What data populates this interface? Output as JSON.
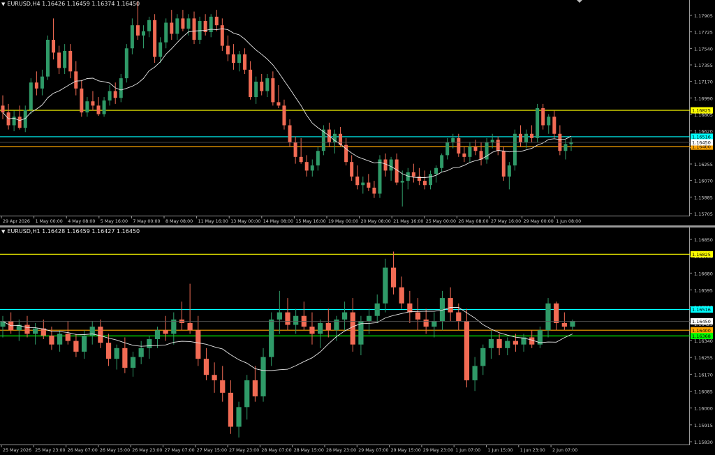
{
  "colors": {
    "bull": "#2f9a68",
    "bear": "#f26b54",
    "ma": "#e6e6e6",
    "axis_text": "#d0d0d0",
    "frame": "#9a9a9a",
    "background": "#000000",
    "price_label": "#ffffff"
  },
  "chart_data": [
    {
      "type": "candlestick",
      "header": "EURUSD,H4  1.16426 1.16459 1.16374 1.16450",
      "ylim": [
        1.1565,
        1.1805
      ],
      "y_ticks": [
        "1.17905",
        "1.17725",
        "1.17540",
        "1.17355",
        "1.17170",
        "1.16990",
        "1.16805",
        "1.16620",
        "1.16435",
        "1.16255",
        "1.16070",
        "1.15885",
        "1.15705"
      ],
      "x_ticks": [
        "29 Apr 2026",
        "1 May 00:00",
        "4 May 08:00",
        "5 May 16:00",
        "7 May 00:00",
        "8 May 08:00",
        "11 May 16:00",
        "13 May 00:00",
        "14 May 08:00",
        "15 May 16:00",
        "19 May 00:00",
        "20 May 08:00",
        "21 May 16:00",
        "25 May 00:00",
        "26 May 08:00",
        "27 May 16:00",
        "29 May 00:00",
        "1 Jun 08:00"
      ],
      "levels": [
        {
          "price": 1.16825,
          "label": "1.16825",
          "color": "#ffff00"
        },
        {
          "price": 1.16516,
          "label": "1.16516",
          "color": "#00ffff"
        },
        {
          "price": 1.164,
          "label": "1.16400",
          "color": "#ffa500"
        }
      ],
      "current_price": {
        "price": 1.1645,
        "label": "1.16450"
      },
      "ohlc": [
        [
          1.1688,
          1.17,
          1.1672,
          1.168
        ],
        [
          1.168,
          1.169,
          1.166,
          1.1665
        ],
        [
          1.1665,
          1.1682,
          1.1658,
          1.1675
        ],
        [
          1.1675,
          1.1688,
          1.166,
          1.1662
        ],
        [
          1.1662,
          1.1688,
          1.1657,
          1.1683
        ],
        [
          1.1683,
          1.172,
          1.1678,
          1.1715
        ],
        [
          1.1715,
          1.1728,
          1.17,
          1.1708
        ],
        [
          1.1708,
          1.173,
          1.17,
          1.1722
        ],
        [
          1.1722,
          1.177,
          1.1718,
          1.1765
        ],
        [
          1.1765,
          1.179,
          1.1742,
          1.175
        ],
        [
          1.175,
          1.1758,
          1.1725,
          1.1732
        ],
        [
          1.1732,
          1.176,
          1.1725,
          1.1752
        ],
        [
          1.1752,
          1.176,
          1.172,
          1.1728
        ],
        [
          1.1728,
          1.174,
          1.17,
          1.1708
        ],
        [
          1.1708,
          1.1718,
          1.1675,
          1.168
        ],
        [
          1.168,
          1.1698,
          1.1675,
          1.1693
        ],
        [
          1.1693,
          1.1705,
          1.1682,
          1.1688
        ],
        [
          1.1688,
          1.1698,
          1.1676,
          1.1678
        ],
        [
          1.1678,
          1.1698,
          1.1675,
          1.1694
        ],
        [
          1.1694,
          1.1712,
          1.1688,
          1.1705
        ],
        [
          1.1705,
          1.1715,
          1.169,
          1.1697
        ],
        [
          1.1697,
          1.1725,
          1.1692,
          1.172
        ],
        [
          1.172,
          1.176,
          1.1715,
          1.1755
        ],
        [
          1.1755,
          1.179,
          1.1748,
          1.1782
        ],
        [
          1.1782,
          1.181,
          1.1765,
          1.177
        ],
        [
          1.177,
          1.1782,
          1.1755,
          1.1775
        ],
        [
          1.1775,
          1.1792,
          1.1768,
          1.1788
        ],
        [
          1.1788,
          1.1795,
          1.1738,
          1.1745
        ],
        [
          1.1745,
          1.1768,
          1.1738,
          1.1762
        ],
        [
          1.1762,
          1.179,
          1.1755,
          1.1785
        ],
        [
          1.1785,
          1.18,
          1.1765,
          1.1772
        ],
        [
          1.1772,
          1.1795,
          1.1765,
          1.179
        ],
        [
          1.179,
          1.18,
          1.1775,
          1.1778
        ],
        [
          1.1778,
          1.1795,
          1.177,
          1.179
        ],
        [
          1.179,
          1.1798,
          1.176,
          1.1765
        ],
        [
          1.1765,
          1.1792,
          1.176,
          1.1787
        ],
        [
          1.1787,
          1.1795,
          1.177,
          1.1774
        ],
        [
          1.1774,
          1.1795,
          1.1768,
          1.1792
        ],
        [
          1.1792,
          1.18,
          1.1775,
          1.1782
        ],
        [
          1.1782,
          1.179,
          1.1752,
          1.1758
        ],
        [
          1.1758,
          1.177,
          1.174,
          1.1748
        ],
        [
          1.1748,
          1.176,
          1.173,
          1.1738
        ],
        [
          1.1738,
          1.1752,
          1.1728,
          1.1748
        ],
        [
          1.1748,
          1.1755,
          1.1725,
          1.173
        ],
        [
          1.173,
          1.174,
          1.1695,
          1.1698
        ],
        [
          1.1698,
          1.1722,
          1.169,
          1.1716
        ],
        [
          1.1716,
          1.1725,
          1.17,
          1.1705
        ],
        [
          1.1705,
          1.1725,
          1.1698,
          1.172
        ],
        [
          1.172,
          1.1728,
          1.1688,
          1.1692
        ],
        [
          1.1692,
          1.1712,
          1.1685,
          1.1688
        ],
        [
          1.1688,
          1.1695,
          1.166,
          1.1665
        ],
        [
          1.1665,
          1.1672,
          1.164,
          1.1645
        ],
        [
          1.1645,
          1.1652,
          1.162,
          1.1628
        ],
        [
          1.1628,
          1.165,
          1.162,
          1.1622
        ],
        [
          1.1622,
          1.163,
          1.1605,
          1.1612
        ],
        [
          1.1612,
          1.1625,
          1.1605,
          1.1618
        ],
        [
          1.1618,
          1.164,
          1.1612,
          1.1635
        ],
        [
          1.1635,
          1.1665,
          1.163,
          1.166
        ],
        [
          1.166,
          1.1668,
          1.164,
          1.1645
        ],
        [
          1.1645,
          1.166,
          1.1632,
          1.1655
        ],
        [
          1.1655,
          1.1663,
          1.164,
          1.1642
        ],
        [
          1.1642,
          1.165,
          1.1618,
          1.1622
        ],
        [
          1.1622,
          1.163,
          1.16,
          1.1605
        ],
        [
          1.1605,
          1.1618,
          1.159,
          1.1595
        ],
        [
          1.1595,
          1.1605,
          1.1585,
          1.1598
        ],
        [
          1.1598,
          1.1608,
          1.1588,
          1.1592
        ],
        [
          1.1592,
          1.16,
          1.158,
          1.1585
        ],
        [
          1.1585,
          1.163,
          1.158,
          1.1625
        ],
        [
          1.1625,
          1.1632,
          1.1605,
          1.1612
        ],
        [
          1.1612,
          1.1628,
          1.16,
          1.1625
        ],
        [
          1.1625,
          1.1632,
          1.1595,
          1.1598
        ],
        [
          1.1598,
          1.1612,
          1.157,
          1.16
        ],
        [
          1.16,
          1.1615,
          1.159,
          1.161
        ],
        [
          1.161,
          1.162,
          1.1598,
          1.1605
        ],
        [
          1.1605,
          1.1615,
          1.1595,
          1.16
        ],
        [
          1.16,
          1.1612,
          1.159,
          1.1595
        ],
        [
          1.1595,
          1.1612,
          1.159,
          1.1608
        ],
        [
          1.1608,
          1.1618,
          1.1598,
          1.1615
        ],
        [
          1.1615,
          1.1632,
          1.161,
          1.163
        ],
        [
          1.163,
          1.165,
          1.1625,
          1.1645
        ],
        [
          1.1645,
          1.1655,
          1.1638,
          1.165
        ],
        [
          1.165,
          1.1655,
          1.1628,
          1.1632
        ],
        [
          1.1632,
          1.164,
          1.1622,
          1.1628
        ],
        [
          1.1628,
          1.1645,
          1.1622,
          1.164
        ],
        [
          1.164,
          1.1648,
          1.163,
          1.1635
        ],
        [
          1.1635,
          1.1645,
          1.1618,
          1.1625
        ],
        [
          1.1625,
          1.165,
          1.162,
          1.1645
        ],
        [
          1.1645,
          1.1655,
          1.1638,
          1.1648
        ],
        [
          1.1648,
          1.1652,
          1.163,
          1.1635
        ],
        [
          1.1635,
          1.164,
          1.16,
          1.1605
        ],
        [
          1.1605,
          1.1622,
          1.159,
          1.1618
        ],
        [
          1.1618,
          1.166,
          1.1612,
          1.1655
        ],
        [
          1.1655,
          1.1665,
          1.164,
          1.1645
        ],
        [
          1.1645,
          1.166,
          1.1638,
          1.1655
        ],
        [
          1.1655,
          1.1665,
          1.1645,
          1.165
        ],
        [
          1.165,
          1.169,
          1.1645,
          1.1685
        ],
        [
          1.1685,
          1.169,
          1.166,
          1.1665
        ],
        [
          1.1665,
          1.1678,
          1.1655,
          1.1675
        ],
        [
          1.1675,
          1.1682,
          1.165,
          1.1655
        ],
        [
          1.1655,
          1.1665,
          1.163,
          1.1635
        ],
        [
          1.1635,
          1.1648,
          1.1625,
          1.1643
        ],
        [
          1.1643,
          1.165,
          1.1635,
          1.1645
        ]
      ]
    },
    {
      "type": "candlestick",
      "header": "EURUSD,H1  1.16428 1.16459 1.16427 1.16450",
      "ylim": [
        1.1578,
        1.1692
      ],
      "y_ticks": [
        "1.16850",
        "1.16765",
        "1.16680",
        "1.16595",
        "1.16510",
        "1.16425",
        "1.16340",
        "1.16255",
        "1.16170",
        "1.16085",
        "1.16000",
        "1.15915",
        "1.15830"
      ],
      "x_ticks": [
        "25 May 2026",
        "25 May 23:00",
        "26 May 07:00",
        "26 May 15:00",
        "26 May 23:00",
        "27 May 07:00",
        "27 May 15:00",
        "27 May 23:00",
        "28 May 07:00",
        "28 May 15:00",
        "28 May 23:00",
        "29 May 07:00",
        "29 May 15:00",
        "29 May 23:00",
        "1 Jun 07:00",
        "1 Jun 15:00",
        "1 Jun 23:00",
        "2 Jun 07:00"
      ],
      "levels": [
        {
          "price": 1.16825,
          "label": "1.16825",
          "color": "#ffff00"
        },
        {
          "price": 1.16516,
          "label": "1.16516",
          "color": "#00ffff"
        },
        {
          "price": 1.164,
          "label": "1.16400",
          "color": "#ffa500"
        },
        {
          "price": 1.16368,
          "label": "1.16368",
          "color": "#00ff00"
        }
      ],
      "current_price": {
        "price": 1.1645,
        "label": "1.16450"
      },
      "ohlc": [
        [
          1.1642,
          1.1648,
          1.1636,
          1.1645
        ],
        [
          1.1645,
          1.165,
          1.1638,
          1.164
        ],
        [
          1.164,
          1.1646,
          1.1634,
          1.1643
        ],
        [
          1.1643,
          1.1648,
          1.1636,
          1.1638
        ],
        [
          1.1638,
          1.1644,
          1.1632,
          1.1641
        ],
        [
          1.1641,
          1.1646,
          1.1635,
          1.1637
        ],
        [
          1.1637,
          1.1642,
          1.1629,
          1.1632
        ],
        [
          1.1632,
          1.164,
          1.1628,
          1.1638
        ],
        [
          1.1638,
          1.1645,
          1.1632,
          1.1634
        ],
        [
          1.1634,
          1.1638,
          1.1625,
          1.1628
        ],
        [
          1.1628,
          1.164,
          1.1624,
          1.1637
        ],
        [
          1.1637,
          1.1645,
          1.1632,
          1.1642
        ],
        [
          1.1642,
          1.1646,
          1.163,
          1.1633
        ],
        [
          1.1633,
          1.1638,
          1.162,
          1.1624
        ],
        [
          1.1624,
          1.1632,
          1.1618,
          1.163
        ],
        [
          1.163,
          1.1636,
          1.1616,
          1.1619
        ],
        [
          1.1619,
          1.1628,
          1.1614,
          1.1625
        ],
        [
          1.1625,
          1.1634,
          1.1621,
          1.163
        ],
        [
          1.163,
          1.1637,
          1.1624,
          1.1635
        ],
        [
          1.1635,
          1.1642,
          1.163,
          1.164
        ],
        [
          1.164,
          1.1648,
          1.1634,
          1.1638
        ],
        [
          1.1638,
          1.165,
          1.1632,
          1.1646
        ],
        [
          1.1646,
          1.1656,
          1.164,
          1.1644
        ],
        [
          1.1644,
          1.1666,
          1.1638,
          1.164
        ],
        [
          1.164,
          1.1648,
          1.162,
          1.1624
        ],
        [
          1.1624,
          1.163,
          1.1612,
          1.1615
        ],
        [
          1.1615,
          1.1622,
          1.1605,
          1.1612
        ],
        [
          1.1612,
          1.162,
          1.16,
          1.1605
        ],
        [
          1.1605,
          1.1612,
          1.1582,
          1.1586
        ],
        [
          1.1586,
          1.16,
          1.158,
          1.1597
        ],
        [
          1.1597,
          1.1615,
          1.159,
          1.1612
        ],
        [
          1.1612,
          1.162,
          1.16,
          1.1603
        ],
        [
          1.1603,
          1.163,
          1.16,
          1.1625
        ],
        [
          1.1625,
          1.165,
          1.162,
          1.1646
        ],
        [
          1.1646,
          1.1662,
          1.1638,
          1.165
        ],
        [
          1.165,
          1.1658,
          1.164,
          1.1643
        ],
        [
          1.1643,
          1.1652,
          1.1638,
          1.1648
        ],
        [
          1.1648,
          1.1656,
          1.164,
          1.1642
        ],
        [
          1.1642,
          1.165,
          1.1632,
          1.1638
        ],
        [
          1.1638,
          1.1646,
          1.163,
          1.1644
        ],
        [
          1.1644,
          1.1652,
          1.1636,
          1.164
        ],
        [
          1.164,
          1.1648,
          1.1634,
          1.1646
        ],
        [
          1.1646,
          1.1656,
          1.164,
          1.165
        ],
        [
          1.165,
          1.1658,
          1.1628,
          1.1632
        ],
        [
          1.1632,
          1.1648,
          1.1626,
          1.1645
        ],
        [
          1.1645,
          1.1652,
          1.1638,
          1.1648
        ],
        [
          1.1648,
          1.166,
          1.1644,
          1.1655
        ],
        [
          1.1655,
          1.168,
          1.165,
          1.1675
        ],
        [
          1.1675,
          1.1684,
          1.166,
          1.1664
        ],
        [
          1.1664,
          1.167,
          1.1652,
          1.1655
        ],
        [
          1.1655,
          1.1662,
          1.1644,
          1.165
        ],
        [
          1.165,
          1.1658,
          1.164,
          1.1646
        ],
        [
          1.1646,
          1.1652,
          1.1638,
          1.1642
        ],
        [
          1.1642,
          1.165,
          1.1636,
          1.1645
        ],
        [
          1.1645,
          1.1662,
          1.164,
          1.1658
        ],
        [
          1.1658,
          1.1664,
          1.1645,
          1.165
        ],
        [
          1.165,
          1.1655,
          1.164,
          1.1645
        ],
        [
          1.1645,
          1.1652,
          1.1608,
          1.1612
        ],
        [
          1.1612,
          1.1625,
          1.1606,
          1.162
        ],
        [
          1.162,
          1.1632,
          1.1615,
          1.163
        ],
        [
          1.163,
          1.164,
          1.1624,
          1.1635
        ],
        [
          1.1635,
          1.1638,
          1.1626,
          1.163
        ],
        [
          1.163,
          1.1636,
          1.1626,
          1.1634
        ],
        [
          1.1634,
          1.1638,
          1.1628,
          1.1632
        ],
        [
          1.1632,
          1.1638,
          1.1628,
          1.1636
        ],
        [
          1.1636,
          1.164,
          1.163,
          1.1632
        ],
        [
          1.1632,
          1.1642,
          1.163,
          1.164
        ],
        [
          1.164,
          1.1658,
          1.1636,
          1.1655
        ],
        [
          1.1655,
          1.1656,
          1.164,
          1.1644
        ],
        [
          1.1644,
          1.165,
          1.164,
          1.1642
        ],
        [
          1.1642,
          1.1646,
          1.164,
          1.1645
        ]
      ]
    }
  ]
}
